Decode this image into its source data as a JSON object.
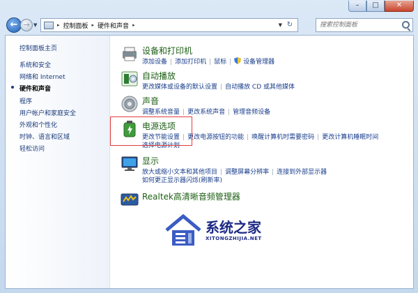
{
  "window": {
    "minimize": "–",
    "maximize": "□",
    "close": "✕"
  },
  "address": {
    "crumbs": [
      "控制面板",
      "硬件和声音"
    ]
  },
  "search": {
    "placeholder": "搜索控制面板"
  },
  "sidebar": {
    "items": [
      {
        "label": "控制面板主页"
      },
      {
        "label": "系统和安全"
      },
      {
        "label": "网络和 Internet"
      },
      {
        "label": "硬件和声音",
        "active": true
      },
      {
        "label": "程序"
      },
      {
        "label": "用户帐户和家庭安全"
      },
      {
        "label": "外观和个性化"
      },
      {
        "label": "时钟、语言和区域"
      },
      {
        "label": "轻松访问"
      }
    ]
  },
  "categories": {
    "devices": {
      "title": "设备和打印机",
      "links": [
        "添加设备",
        "添加打印机",
        "鼠标",
        "设备管理器"
      ]
    },
    "autoplay": {
      "title": "自动播放",
      "links": [
        "更改媒体或设备的默认设置",
        "自动播放 CD 或其他媒体"
      ]
    },
    "sound": {
      "title": "声音",
      "links": [
        "调整系统音量",
        "更改系统声音",
        "管理音频设备"
      ]
    },
    "power": {
      "title": "电源选项",
      "links": [
        "更改节能设置",
        "更改电源按钮的功能",
        "唤醒计算机时需要密码",
        "更改计算机睡眠时间"
      ],
      "links2": [
        "选择电源计划"
      ]
    },
    "display": {
      "title": "显示",
      "links": [
        "放大或缩小文本和其他项目",
        "调整屏幕分辨率",
        "连接到外部显示器"
      ],
      "links2": [
        "如何更正显示器闪烁(刷新率)"
      ]
    },
    "realtek": {
      "title": "Realtek高清晰音频管理器"
    }
  },
  "watermark": {
    "title": "系统之家",
    "subtitle": "XITONGZHIJIA.NET"
  },
  "colors": {
    "link": "#1a3e8c",
    "category_title": "#1b5e12",
    "highlight": "#e23c3c"
  }
}
